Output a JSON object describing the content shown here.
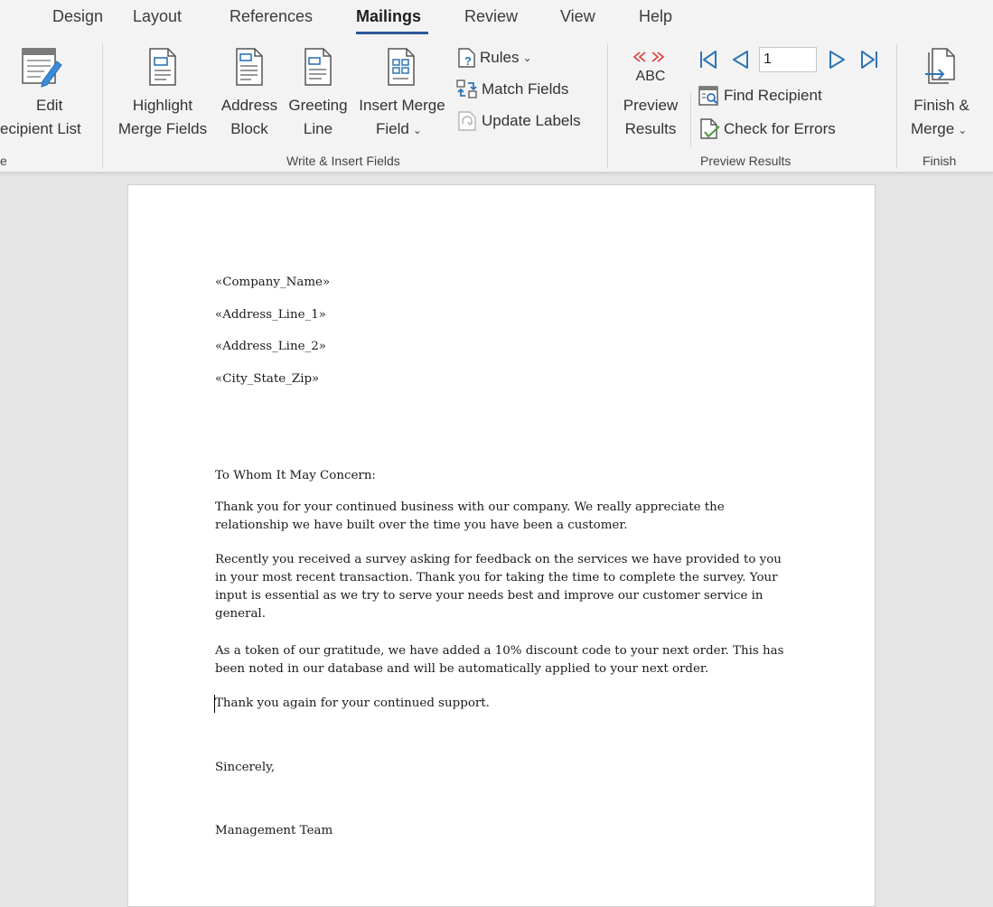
{
  "tabs": [
    {
      "label": "Design"
    },
    {
      "label": "Layout"
    },
    {
      "label": "References"
    },
    {
      "label": "Mailings",
      "active": true
    },
    {
      "label": "Review"
    },
    {
      "label": "View"
    },
    {
      "label": "Help"
    }
  ],
  "ribbon": {
    "start_group": {
      "edit_list_line1": "Edit",
      "edit_list_line2": "ecipient List",
      "group_label": "e"
    },
    "write_insert": {
      "highlight_line1": "Highlight",
      "highlight_line2": "Merge Fields",
      "address_line1": "Address",
      "address_line2": "Block",
      "greeting_line1": "Greeting",
      "greeting_line2": "Line",
      "insert_line1": "Insert Merge",
      "insert_line2": "Field",
      "rules": "Rules",
      "match_fields": "Match Fields",
      "update_labels": "Update Labels",
      "group_label": "Write & Insert Fields"
    },
    "preview": {
      "abc_label": "ABC",
      "preview_line1": "Preview",
      "preview_line2": "Results",
      "record_value": "1",
      "find_recipient": "Find Recipient",
      "check_errors": "Check for Errors",
      "group_label": "Preview Results"
    },
    "finish": {
      "finish_line1": "Finish &",
      "finish_line2": "Merge",
      "group_label": "Finish"
    }
  },
  "document": {
    "merge_fields": [
      "«Company_Name»",
      "«Address_Line_1»",
      "«Address_Line_2»",
      "«City_State_Zip»"
    ],
    "salutation": "To Whom It May Concern:",
    "paragraphs": [
      "Thank you for your continued business with our company.  We really appreciate the relationship we have built over the time you have been a customer.",
      "Recently you received a survey asking for feedback on the services we have provided to you in your most recent transaction.  Thank you for taking the time to complete the survey.  Your input is essential as we try to serve your needs best and improve our customer service in general.",
      "As a token of our gratitude, we have added a 10% discount code to your next order.  This has been noted in our database and will be automatically applied to your next order.",
      "Thank you again for your continued support."
    ],
    "closing": "Sincerely,",
    "signature": "Management Team"
  },
  "colors": {
    "accent": "#2b579a",
    "icon_blue": "#2e75b6",
    "merge_red": "#e03b3b"
  }
}
